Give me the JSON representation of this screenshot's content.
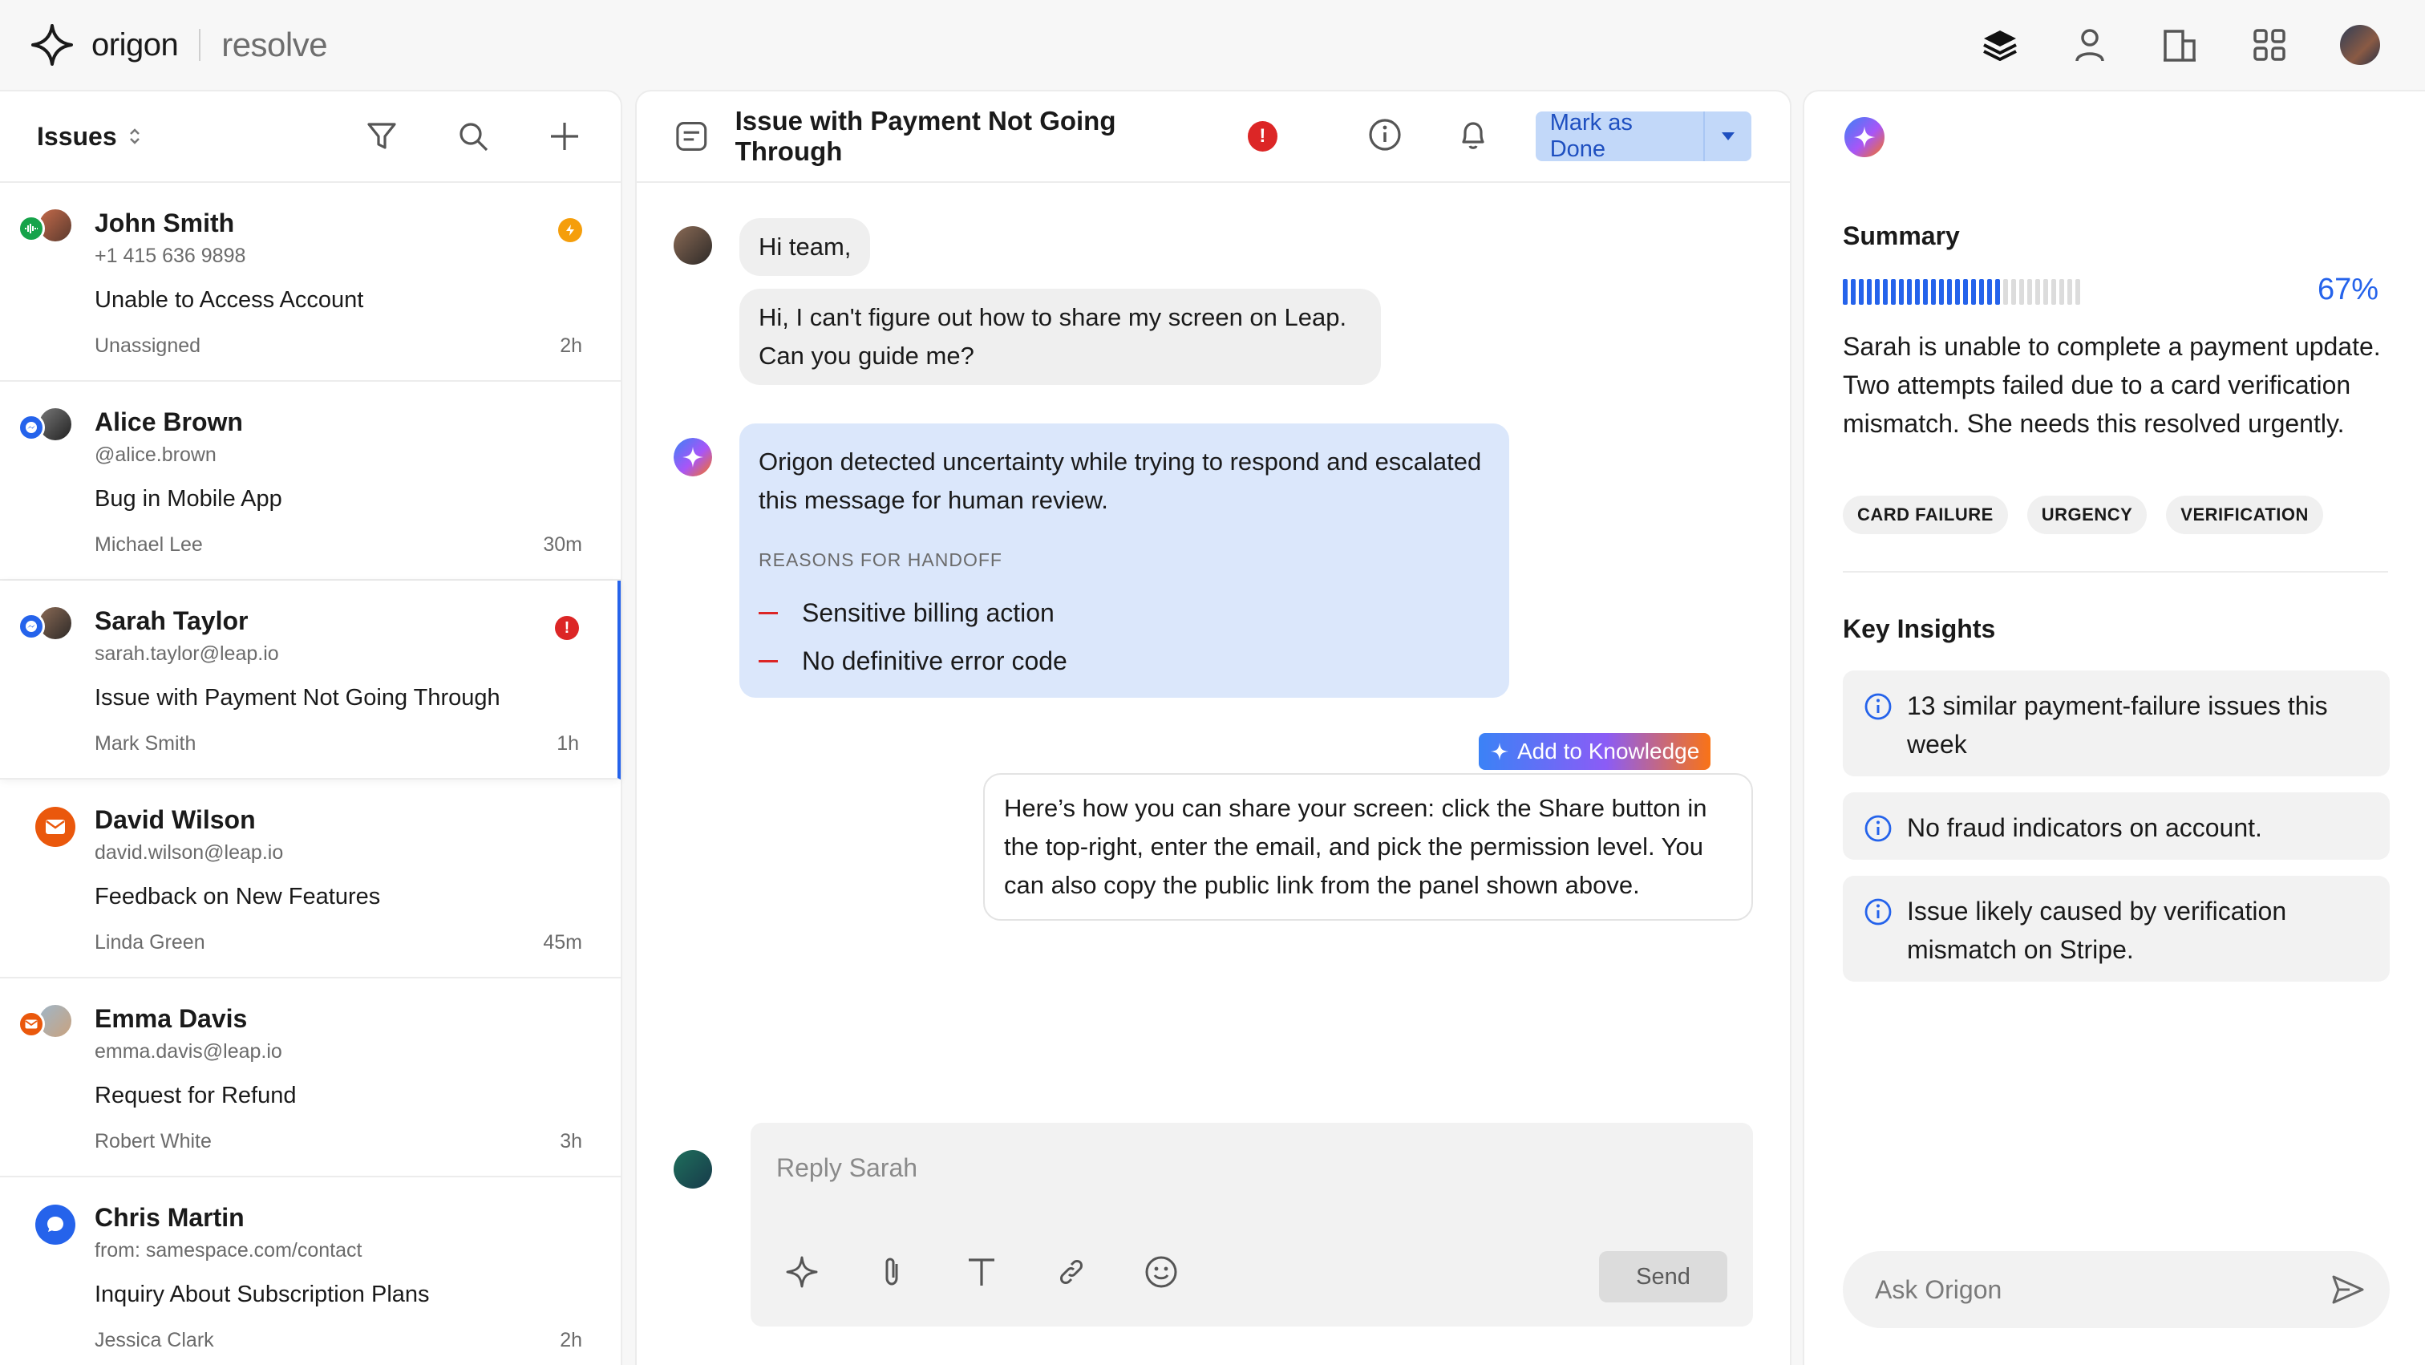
{
  "brand": {
    "name": "origon",
    "product": "resolve"
  },
  "colors": {
    "accent": "#2563eb",
    "alert": "#dc2626",
    "warning": "#f59e0b",
    "email": "#ea580c"
  },
  "left": {
    "title": "Issues",
    "issues": [
      {
        "name": "John Smith",
        "sub": "+1 415 636 9898",
        "subject": "Unable to Access Account",
        "assignee": "Unassigned",
        "time": "2h",
        "channel": "phone-icon",
        "badge": "warning"
      },
      {
        "name": "Alice Brown",
        "sub": "@alice.brown",
        "subject": "Bug in Mobile App",
        "assignee": "Michael Lee",
        "time": "30m",
        "channel": "messenger-icon",
        "badge": ""
      },
      {
        "name": "Sarah Taylor",
        "sub": "sarah.taylor@leap.io",
        "subject": "Issue with Payment Not Going Through",
        "assignee": "Mark Smith",
        "time": "1h",
        "channel": "messenger-icon",
        "badge": "alert",
        "selected": true
      },
      {
        "name": "David Wilson",
        "sub": "david.wilson@leap.io",
        "subject": "Feedback on New Features",
        "assignee": "Linda Green",
        "time": "45m",
        "channel": "email-icon",
        "badge": ""
      },
      {
        "name": "Emma Davis",
        "sub": "emma.davis@leap.io",
        "subject": "Request for Refund",
        "assignee": "Robert White",
        "time": "3h",
        "channel": "email-icon",
        "badge": ""
      },
      {
        "name": "Chris Martin",
        "sub": "from: samespace.com/contact",
        "subject": "Inquiry About Subscription Plans",
        "assignee": "Jessica Clark",
        "time": "2h",
        "channel": "chat-icon",
        "badge": ""
      }
    ]
  },
  "thread": {
    "title": "Issue with Payment Not Going Through",
    "mark_done": "Mark as Done",
    "messages": {
      "m1": "Hi team,",
      "m2": "Hi, I can't figure out how to share my screen on Leap. Can you guide me?",
      "handoff": "Origon detected uncertainty while trying to respond and escalated this message for human review.",
      "reasons_title": "REASONS FOR HANDOFF",
      "reasons": [
        "Sensitive billing action",
        "No definitive error code"
      ],
      "add_knowledge": "Add to Knowledge",
      "reply": "Here’s how you can share your screen: click the Share button in the top-right, enter the email, and pick the permission level. You can also copy the public link from the panel shown above."
    },
    "composer": {
      "placeholder": "Reply Sarah",
      "send": "Send"
    }
  },
  "assistant": {
    "summary_title": "Summary",
    "progress_percent": 67,
    "progress_label": "67%",
    "summary": "Sarah is unable to complete a payment update. Two attempts failed due to a card verification mismatch. She needs this resolved urgently.",
    "tags": [
      "CARD FAILURE",
      "URGENCY",
      "VERIFICATION"
    ],
    "insights_title": "Key Insights",
    "insights": [
      "13 similar payment-failure issues this week",
      "No fraud indicators on account.",
      "Issue likely caused by verification mismatch on Stripe."
    ],
    "ask_placeholder": "Ask Origon"
  }
}
